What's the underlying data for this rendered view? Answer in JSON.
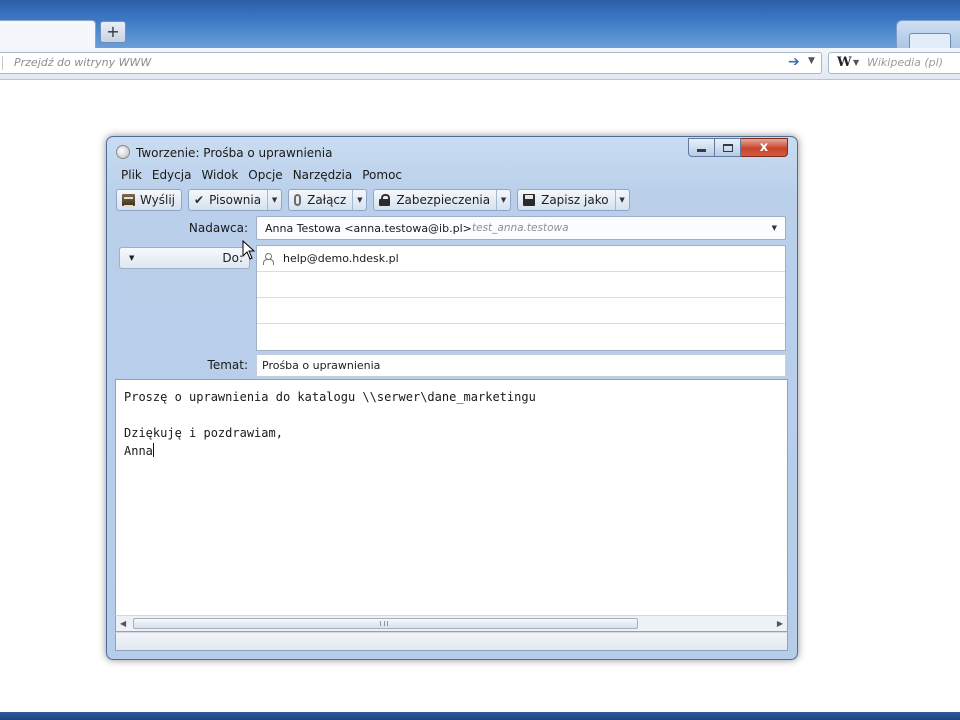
{
  "browser": {
    "new_tab_label": "+",
    "url_placeholder": "Przejdź do witryny WWW",
    "search_engine_logo": "W",
    "search_placeholder": "Wikipedia (pl)"
  },
  "window": {
    "title": "Tworzenie: Prośba o uprawnienia",
    "close_label": "x"
  },
  "menu": [
    {
      "label": "Plik"
    },
    {
      "label": "Edycja"
    },
    {
      "label": "Widok"
    },
    {
      "label": "Opcje"
    },
    {
      "label": "Narzędzia"
    },
    {
      "label": "Pomoc"
    }
  ],
  "toolbar": {
    "send_label": "Wyślij",
    "spelling_label": "Pisownia",
    "attach_label": "Załącz",
    "security_label": "Zabezpieczenia",
    "save_as_label": "Zapisz jako"
  },
  "header": {
    "from_label": "Nadawca:",
    "from_value": "Anna Testowa <anna.testowa@ib.pl>",
    "from_identity": "test_anna.testowa",
    "to_type_label": "Do:",
    "recipients": [
      "help@demo.hdesk.pl",
      "",
      "",
      ""
    ],
    "subject_label": "Temat:",
    "subject_value": "Prośba  o uprawnienia"
  },
  "body": {
    "lines": [
      "Proszę o uprawnienia do katalogu \\\\serwer\\dane_marketingu",
      "",
      "Dziękuję i pozdrawiam,",
      "Anna"
    ]
  },
  "colors": {
    "window_frame": "#b9cfea",
    "title_close": "#c7442b",
    "browser_top": "#3f7bc8"
  }
}
